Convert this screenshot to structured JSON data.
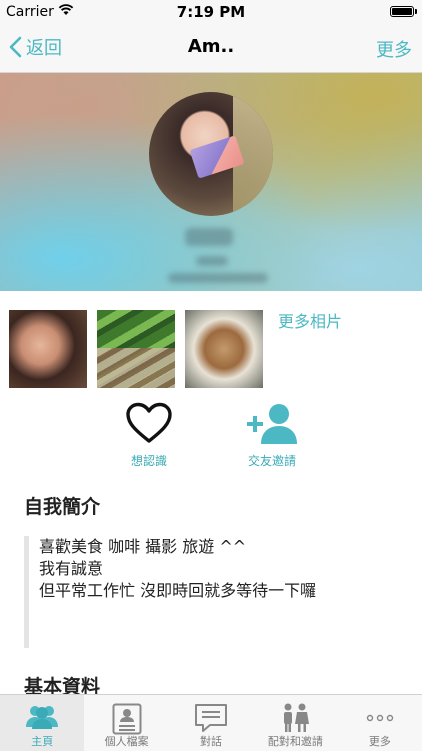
{
  "status": {
    "carrier": "Carrier",
    "time": "7:19 PM"
  },
  "nav": {
    "back": "返回",
    "title": "Am..",
    "more": "更多"
  },
  "photos": {
    "more_label": "更多相片"
  },
  "actions": {
    "like": "想認識",
    "invite": "交友邀請"
  },
  "intro": {
    "heading": "自我簡介",
    "lines": [
      "喜歡美食 咖啡 攝影 旅遊 ^^",
      "我有誠意",
      "但平常工作忙 沒即時回就多等待一下囉"
    ]
  },
  "basic": {
    "heading": "基本資料"
  },
  "tabs": [
    {
      "label": "主頁"
    },
    {
      "label": "個人檔案"
    },
    {
      "label": "對話"
    },
    {
      "label": "配對和邀請"
    },
    {
      "label": "更多"
    }
  ],
  "colors": {
    "accent": "#4cb8c4",
    "tab_active": "#3aaab6"
  }
}
